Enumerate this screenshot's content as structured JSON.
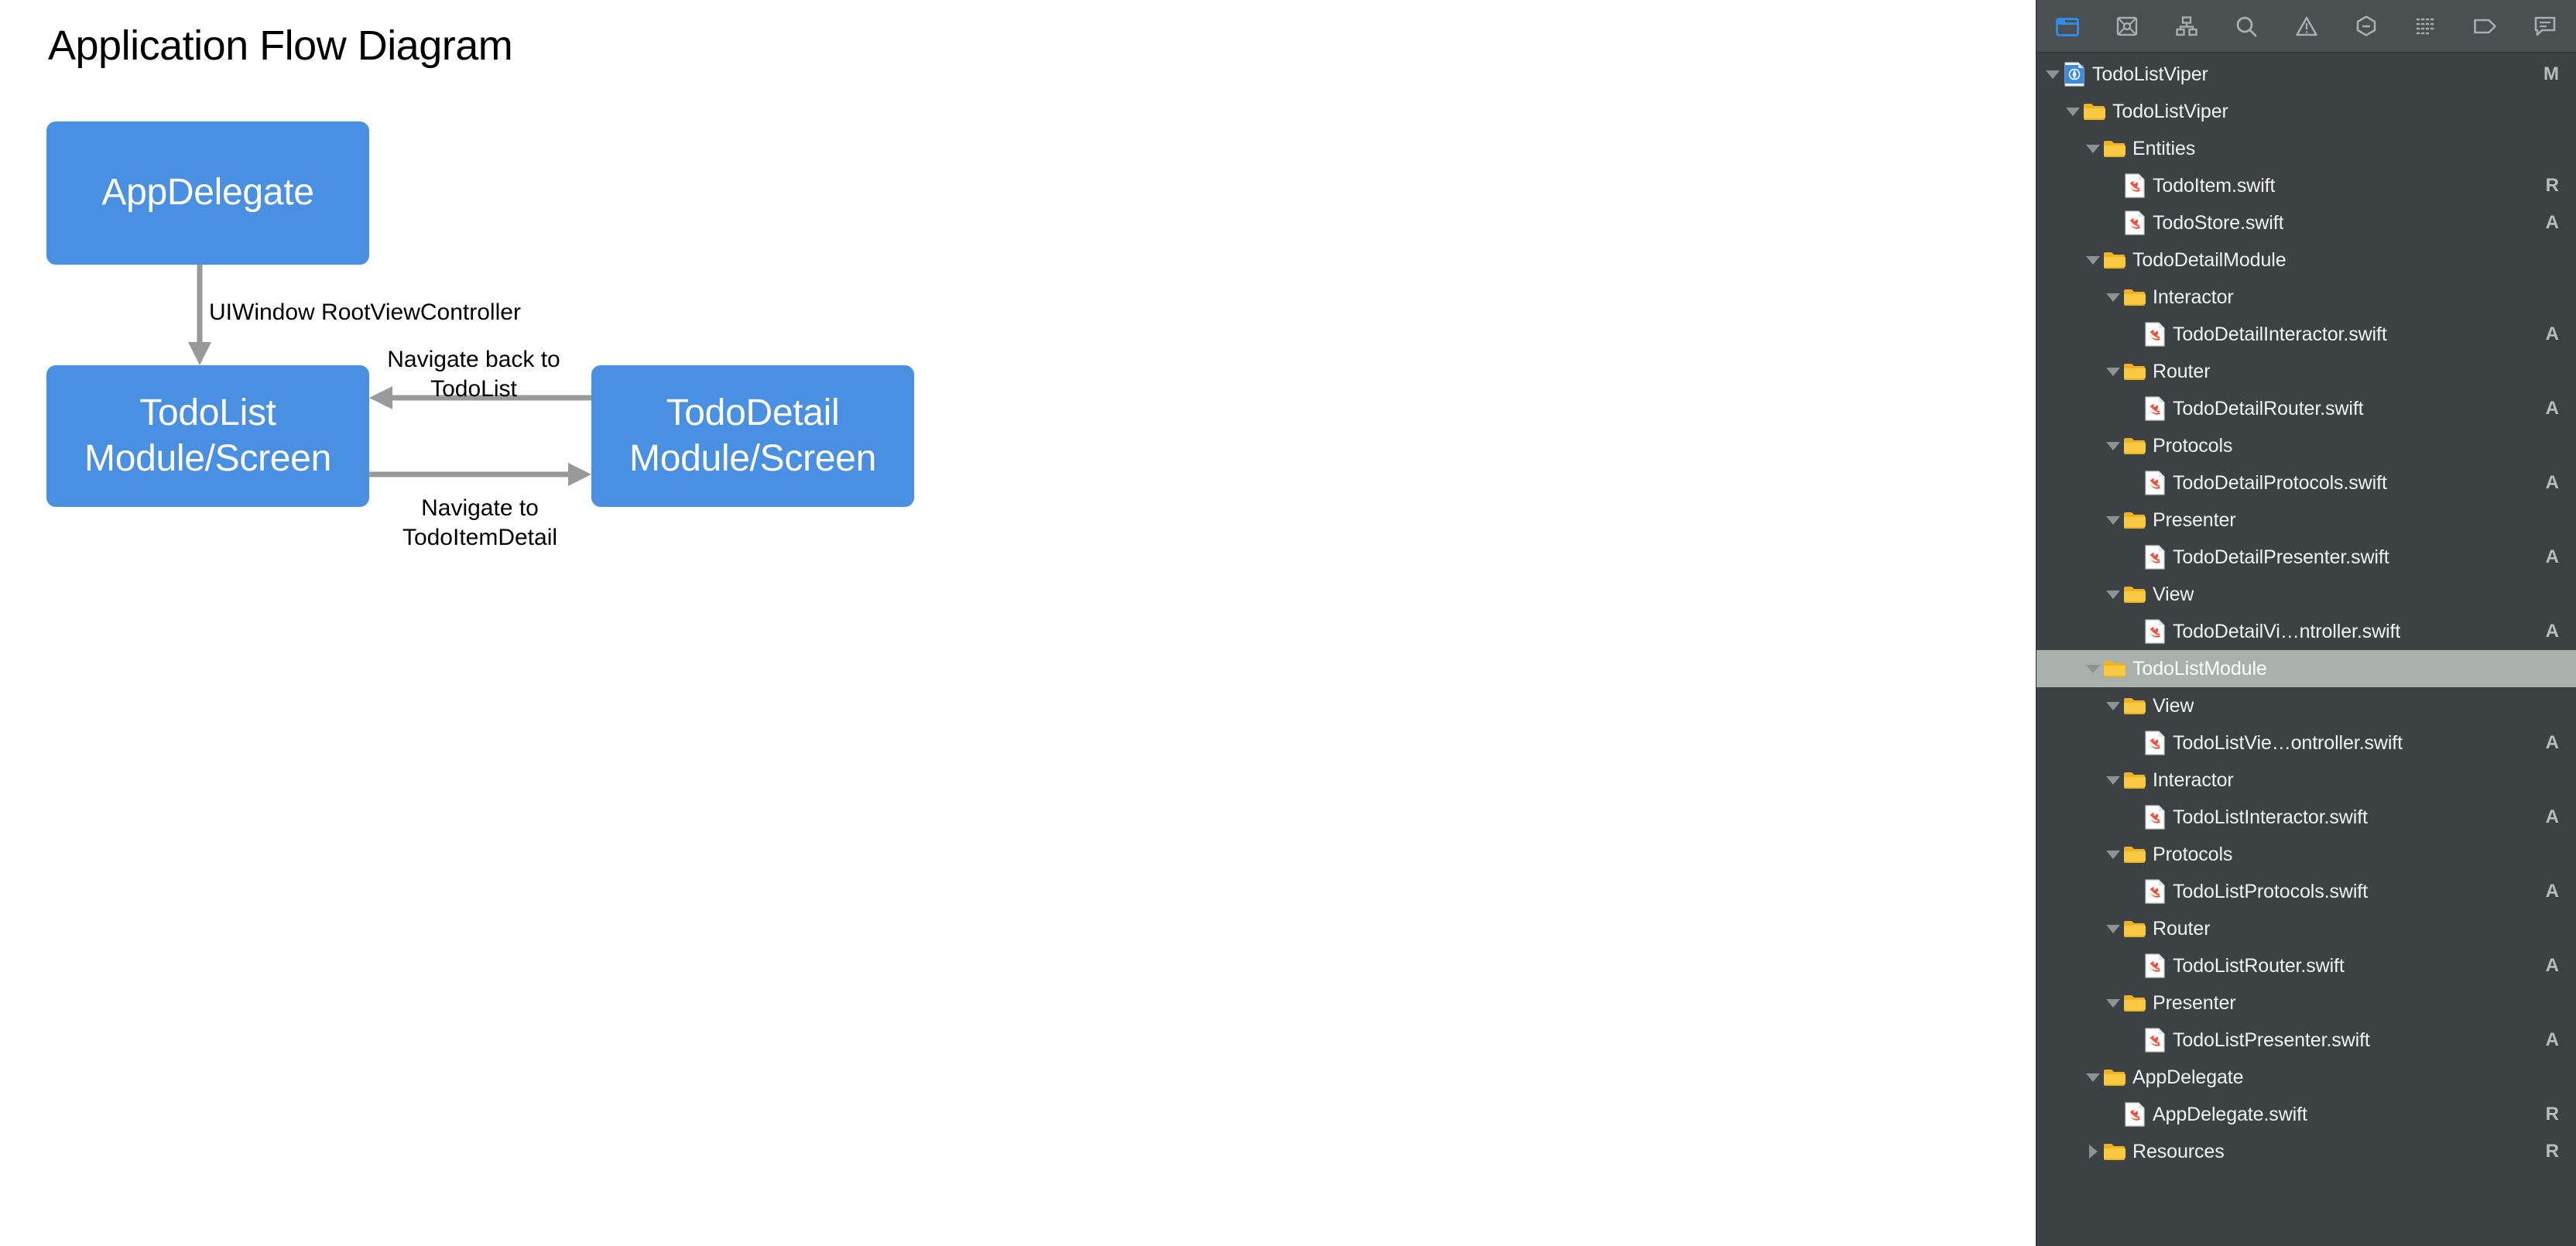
{
  "diagram": {
    "title": "Application Flow Diagram",
    "accent_color": "#4a90e2",
    "arrow_color": "#999999",
    "nodes": {
      "appdelegate": "AppDelegate",
      "todolist": "TodoList\nModule/Screen",
      "tododetail": "TodoDetail\nModule/Screen"
    },
    "edges": {
      "root_view_controller": "UIWindow RootViewController",
      "navigate_back": "Navigate back to\nTodoList",
      "navigate_forward": "Navigate to\nTodoItemDetail"
    }
  },
  "navigator": {
    "toolbar": [
      {
        "name": "folder-icon",
        "active": true
      },
      {
        "name": "source-control-icon",
        "active": false
      },
      {
        "name": "symbol-hierarchy-icon",
        "active": false
      },
      {
        "name": "search-icon",
        "active": false
      },
      {
        "name": "warning-icon",
        "active": false
      },
      {
        "name": "test-icon",
        "active": false
      },
      {
        "name": "debug-icon",
        "active": false
      },
      {
        "name": "breakpoint-icon",
        "active": false
      },
      {
        "name": "report-icon",
        "active": false
      }
    ],
    "tree": [
      {
        "label": "TodoListViper",
        "indent": 0,
        "kind": "project",
        "state": "expanded",
        "status": "M"
      },
      {
        "label": "TodoListViper",
        "indent": 1,
        "kind": "folder",
        "state": "expanded",
        "status": ""
      },
      {
        "label": "Entities",
        "indent": 2,
        "kind": "folder",
        "state": "expanded",
        "status": ""
      },
      {
        "label": "TodoItem.swift",
        "indent": 3,
        "kind": "swift",
        "state": "leaf",
        "status": "R"
      },
      {
        "label": "TodoStore.swift",
        "indent": 3,
        "kind": "swift",
        "state": "leaf",
        "status": "A"
      },
      {
        "label": "TodoDetailModule",
        "indent": 2,
        "kind": "folder",
        "state": "expanded",
        "status": ""
      },
      {
        "label": "Interactor",
        "indent": 3,
        "kind": "folder",
        "state": "expanded",
        "status": ""
      },
      {
        "label": "TodoDetailInteractor.swift",
        "indent": 4,
        "kind": "swift",
        "state": "leaf",
        "status": "A"
      },
      {
        "label": "Router",
        "indent": 3,
        "kind": "folder",
        "state": "expanded",
        "status": ""
      },
      {
        "label": "TodoDetailRouter.swift",
        "indent": 4,
        "kind": "swift",
        "state": "leaf",
        "status": "A"
      },
      {
        "label": "Protocols",
        "indent": 3,
        "kind": "folder",
        "state": "expanded",
        "status": ""
      },
      {
        "label": "TodoDetailProtocols.swift",
        "indent": 4,
        "kind": "swift",
        "state": "leaf",
        "status": "A"
      },
      {
        "label": "Presenter",
        "indent": 3,
        "kind": "folder",
        "state": "expanded",
        "status": ""
      },
      {
        "label": "TodoDetailPresenter.swift",
        "indent": 4,
        "kind": "swift",
        "state": "leaf",
        "status": "A"
      },
      {
        "label": "View",
        "indent": 3,
        "kind": "folder",
        "state": "expanded",
        "status": ""
      },
      {
        "label": "TodoDetailVi…ntroller.swift",
        "indent": 4,
        "kind": "swift",
        "state": "leaf",
        "status": "A"
      },
      {
        "label": "TodoListModule",
        "indent": 2,
        "kind": "folder",
        "state": "expanded",
        "status": "",
        "selected": true
      },
      {
        "label": "View",
        "indent": 3,
        "kind": "folder",
        "state": "expanded",
        "status": ""
      },
      {
        "label": "TodoListVie…ontroller.swift",
        "indent": 4,
        "kind": "swift",
        "state": "leaf",
        "status": "A"
      },
      {
        "label": "Interactor",
        "indent": 3,
        "kind": "folder",
        "state": "expanded",
        "status": ""
      },
      {
        "label": "TodoListInteractor.swift",
        "indent": 4,
        "kind": "swift",
        "state": "leaf",
        "status": "A"
      },
      {
        "label": "Protocols",
        "indent": 3,
        "kind": "folder",
        "state": "expanded",
        "status": ""
      },
      {
        "label": "TodoListProtocols.swift",
        "indent": 4,
        "kind": "swift",
        "state": "leaf",
        "status": "A"
      },
      {
        "label": "Router",
        "indent": 3,
        "kind": "folder",
        "state": "expanded",
        "status": ""
      },
      {
        "label": "TodoListRouter.swift",
        "indent": 4,
        "kind": "swift",
        "state": "leaf",
        "status": "A"
      },
      {
        "label": "Presenter",
        "indent": 3,
        "kind": "folder",
        "state": "expanded",
        "status": ""
      },
      {
        "label": "TodoListPresenter.swift",
        "indent": 4,
        "kind": "swift",
        "state": "leaf",
        "status": "A"
      },
      {
        "label": "AppDelegate",
        "indent": 2,
        "kind": "folder",
        "state": "expanded",
        "status": ""
      },
      {
        "label": "AppDelegate.swift",
        "indent": 3,
        "kind": "swift",
        "state": "leaf",
        "status": "R"
      },
      {
        "label": "Resources",
        "indent": 2,
        "kind": "folder",
        "state": "collapsed",
        "status": "R"
      }
    ]
  }
}
